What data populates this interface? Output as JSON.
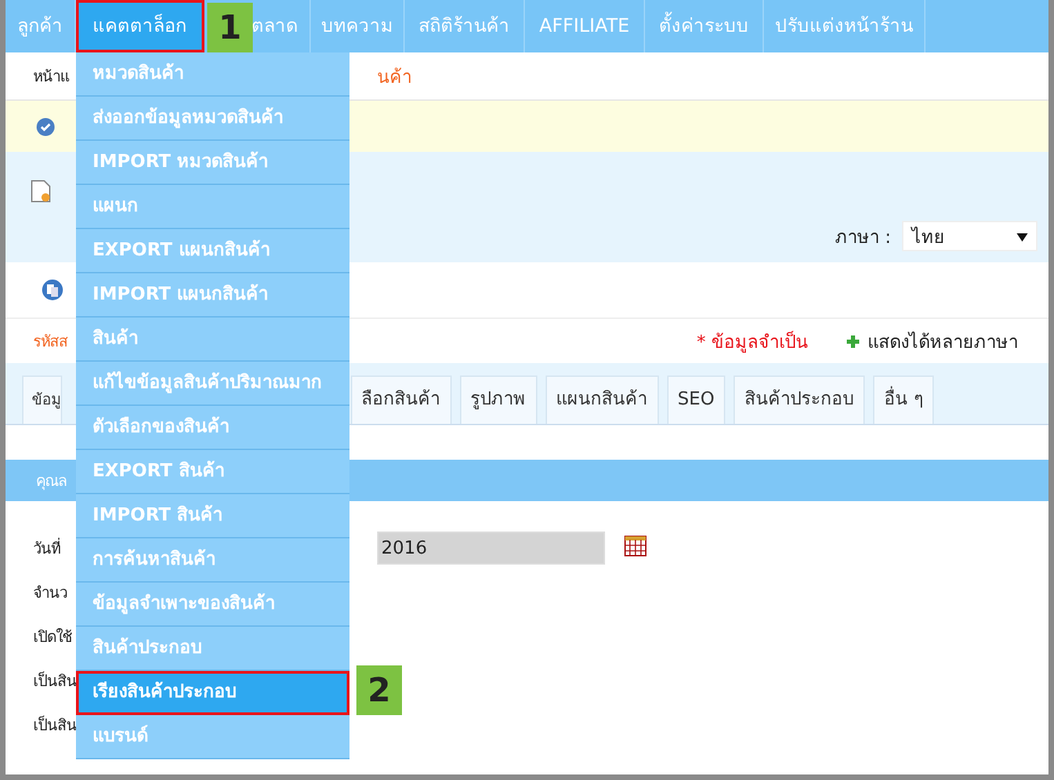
{
  "nav": [
    {
      "label": "ลูกค้า",
      "selected": false
    },
    {
      "label": "แคตตาล็อก",
      "selected": true
    },
    {
      "label": "ตลาด",
      "selected": false
    },
    {
      "label": "บทความ",
      "selected": false
    },
    {
      "label": "สถิติร้านค้า",
      "selected": false
    },
    {
      "label": "AFFILIATE",
      "selected": false
    },
    {
      "label": "ตั้งค่าระบบ",
      "selected": false
    },
    {
      "label": "ปรับแต่งหน้าร้าน",
      "selected": false
    }
  ],
  "steps": [
    {
      "label": "1"
    },
    {
      "label": "2"
    }
  ],
  "dropdown": [
    {
      "label": "หมวดสินค้า",
      "selected": false
    },
    {
      "label": "ส่งออกข้อมูลหมวดสินค้า",
      "selected": false
    },
    {
      "label": "IMPORT หมวดสินค้า",
      "selected": false
    },
    {
      "label": "แผนก",
      "selected": false
    },
    {
      "label": "EXPORT แผนกสินค้า",
      "selected": false
    },
    {
      "label": "IMPORT แผนกสินค้า",
      "selected": false
    },
    {
      "label": "สินค้า",
      "selected": false
    },
    {
      "label": "แก้ไขข้อมูลสินค้าปริมาณมาก",
      "selected": false
    },
    {
      "label": "ตัวเลือกของสินค้า",
      "selected": false
    },
    {
      "label": "EXPORT สินค้า",
      "selected": false
    },
    {
      "label": "IMPORT สินค้า",
      "selected": false
    },
    {
      "label": "การค้นหาสินค้า",
      "selected": false
    },
    {
      "label": "ข้อมูลจำเพาะของสินค้า",
      "selected": false
    },
    {
      "label": "สินค้าประกอบ",
      "selected": false
    },
    {
      "label": "เรียงสินค้าประกอบ",
      "selected": true
    },
    {
      "label": "แบรนด์",
      "selected": false
    }
  ],
  "breadcrumb": {
    "left": "หน้าแ",
    "right": "นค้า"
  },
  "language": {
    "label": "ภาษา :",
    "value": "ไทย"
  },
  "code_row": {
    "label": "รหัสส",
    "required": "* ข้อมูลจำเป็น",
    "multilang": "แสดงได้หลายภาษา"
  },
  "tabs": [
    "ข้อมู",
    "ลือกสินค้า",
    "รูปภาพ",
    "แผนกสินค้า",
    "SEO",
    "สินค้าประกอบ",
    "อื่น ๆ"
  ],
  "section_title": "คุณล",
  "form": [
    {
      "label": "วันที่",
      "value": "2016"
    },
    {
      "label": "จำนว"
    },
    {
      "label": "เปิดใช้"
    },
    {
      "label": "เป็นสิน"
    },
    {
      "label": "เป็นสิน"
    }
  ]
}
